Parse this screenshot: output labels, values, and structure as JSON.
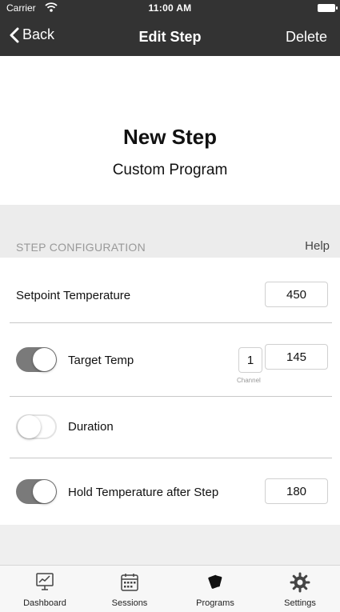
{
  "status_bar": {
    "carrier": "Carrier",
    "time": "11:00 AM"
  },
  "nav": {
    "back_label": "Back",
    "title": "Edit Step",
    "delete_label": "Delete"
  },
  "header": {
    "step_name": "New Step",
    "program_name": "Custom Program"
  },
  "section": {
    "title": "STEP CONFIGURATION",
    "help_label": "Help"
  },
  "rows": {
    "setpoint": {
      "label": "Setpoint Temperature",
      "value": "450"
    },
    "target_temp": {
      "label": "Target Temp",
      "enabled": true,
      "channel": "1",
      "channel_caption": "Channel",
      "value": "145"
    },
    "duration": {
      "label": "Duration",
      "enabled": false
    },
    "hold_temp": {
      "label": "Hold Temperature after Step",
      "enabled": true,
      "value": "180"
    }
  },
  "tabs": [
    {
      "label": "Dashboard",
      "icon": "dashboard-icon"
    },
    {
      "label": "Sessions",
      "icon": "calendar-icon"
    },
    {
      "label": "Programs",
      "icon": "cards-icon"
    },
    {
      "label": "Settings",
      "icon": "gear-icon"
    }
  ],
  "colors": {
    "bar": "#333333",
    "toggle_on": "#7a7a7a",
    "background": "#efefef"
  }
}
